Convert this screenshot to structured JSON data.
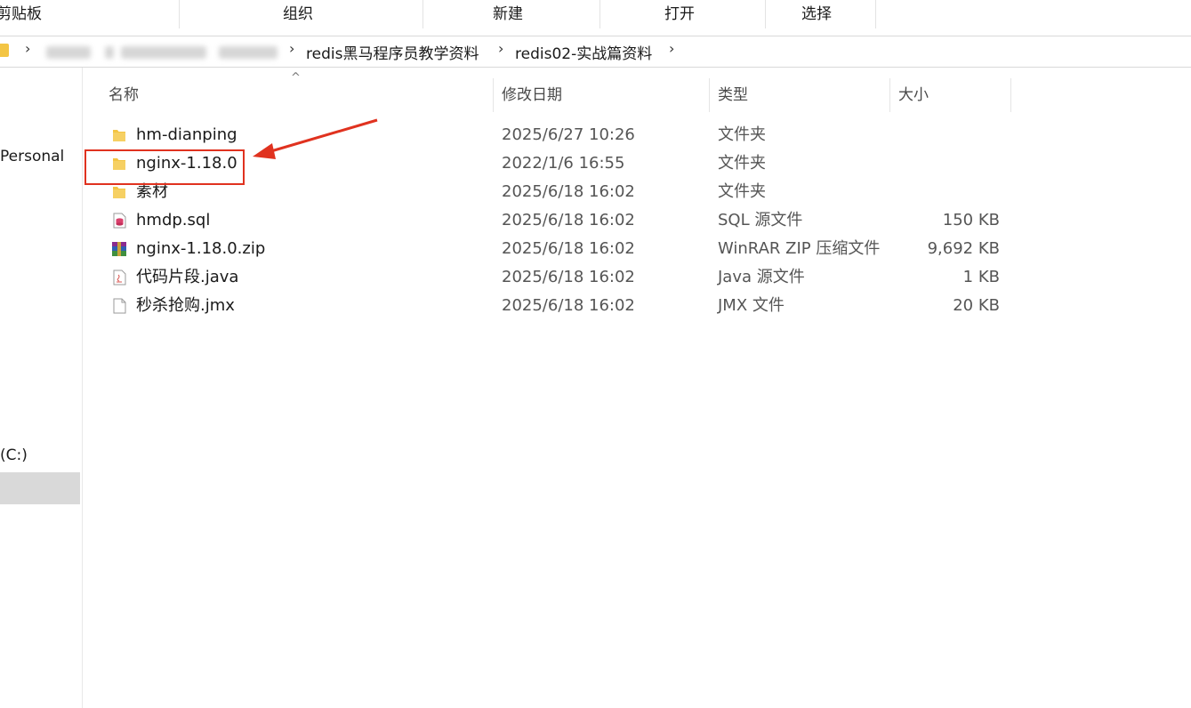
{
  "ribbon": {
    "clipboard": "剪贴板",
    "organize": "组织",
    "new": "新建",
    "open": "打开",
    "select": "选择"
  },
  "address": {
    "crumbs": [
      "redis黑马程序员教学资料",
      "redis02-实战篇资料"
    ]
  },
  "nav": {
    "items": [
      "Personal",
      "(C:)"
    ]
  },
  "columns": {
    "name": "名称",
    "date": "修改日期",
    "type": "类型",
    "size": "大小"
  },
  "files": [
    {
      "name": "hm-dianping",
      "date": "2025/6/27 10:26",
      "type": "文件夹",
      "size": "",
      "icon": "folder-icon"
    },
    {
      "name": "nginx-1.18.0",
      "date": "2022/1/6 16:55",
      "type": "文件夹",
      "size": "",
      "icon": "folder-icon"
    },
    {
      "name": "素材",
      "date": "2025/6/18 16:02",
      "type": "文件夹",
      "size": "",
      "icon": "folder-icon"
    },
    {
      "name": "hmdp.sql",
      "date": "2025/6/18 16:02",
      "type": "SQL 源文件",
      "size": "150 KB",
      "icon": "sql-file-icon"
    },
    {
      "name": "nginx-1.18.0.zip",
      "date": "2025/6/18 16:02",
      "type": "WinRAR ZIP 压缩文件",
      "size": "9,692 KB",
      "icon": "winrar-zip-icon"
    },
    {
      "name": "代码片段.java",
      "date": "2025/6/18 16:02",
      "type": "Java 源文件",
      "size": "1 KB",
      "icon": "java-file-icon"
    },
    {
      "name": "秒杀抢购.jmx",
      "date": "2025/6/18 16:02",
      "type": "JMX 文件",
      "size": "20 KB",
      "icon": "blank-file-icon"
    }
  ],
  "colors": {
    "folder": "#f3c544",
    "annotation": "#e0321f",
    "selected": "#d9d9d9"
  }
}
